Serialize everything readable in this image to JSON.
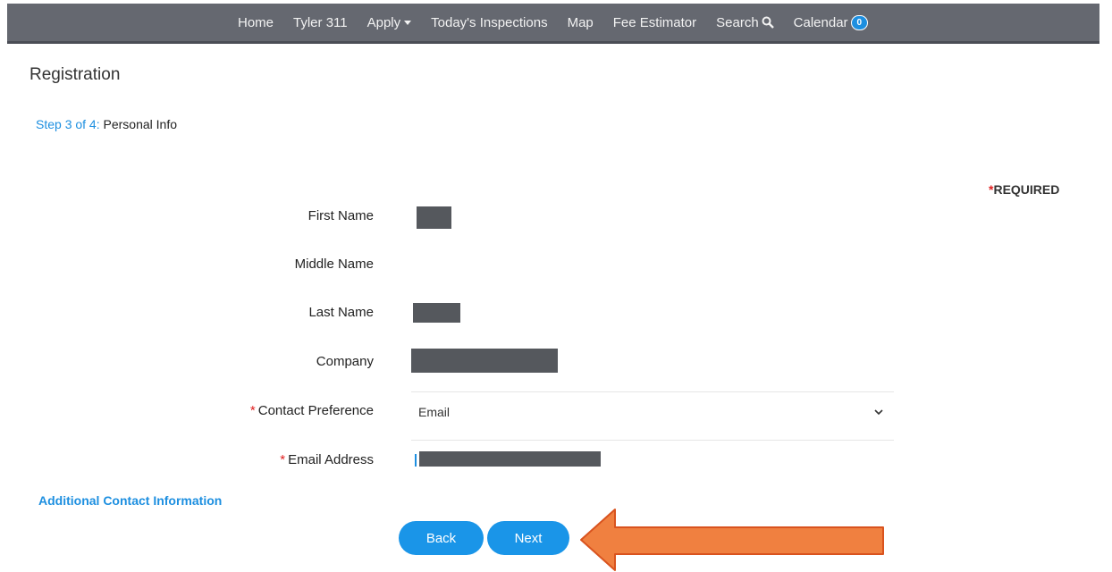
{
  "nav": {
    "items": [
      {
        "label": "Home"
      },
      {
        "label": "Tyler 311"
      },
      {
        "label": "Apply"
      },
      {
        "label": "Today's Inspections"
      },
      {
        "label": "Map"
      },
      {
        "label": "Fee Estimator"
      },
      {
        "label": "Search"
      },
      {
        "label": "Calendar"
      }
    ],
    "calendar_count": "0"
  },
  "page": {
    "title": "Registration",
    "step_prefix": "Step 3 of 4:",
    "step_label": " Personal Info",
    "required_label": "REQUIRED"
  },
  "form": {
    "first_name_label": "First Name",
    "middle_name_label": "Middle Name",
    "last_name_label": "Last Name",
    "company_label": "Company",
    "contact_pref_label": "Contact Preference",
    "contact_pref_value": "Email",
    "email_label": "Email Address"
  },
  "links": {
    "additional_contact": "Additional Contact Information"
  },
  "buttons": {
    "back": "Back",
    "next": "Next"
  },
  "colors": {
    "navbar": "#656870",
    "accent": "#1d8fe0",
    "required_star": "#e02020",
    "arrow": "#f08040"
  },
  "icons": {
    "search": "search-icon",
    "apply_dropdown": "caret-down-icon",
    "select": "chevron-down-icon",
    "annotation": "arrow-left-icon"
  }
}
